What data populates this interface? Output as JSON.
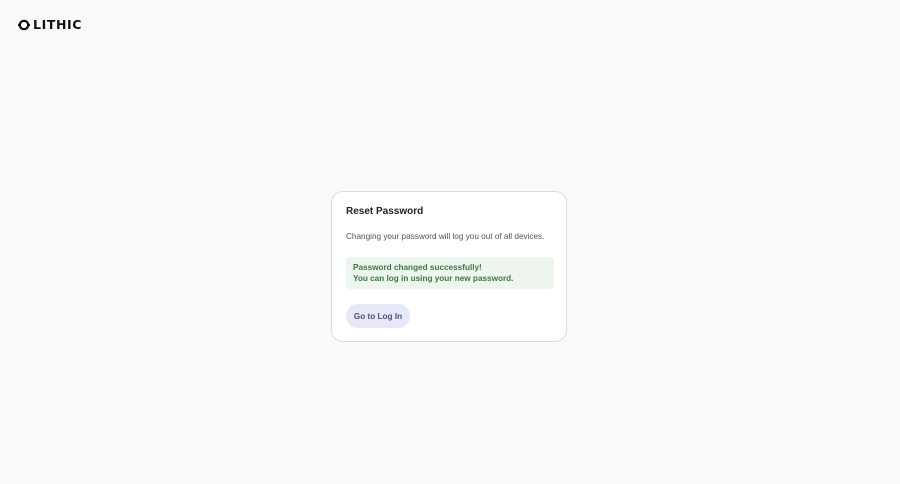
{
  "brand": {
    "name": "LITHIC",
    "logo_icon": "lithic-logo-mark"
  },
  "reset_card": {
    "title": "Reset Password",
    "description": "Changing your password will log you out of all devices.",
    "alert": {
      "line1": "Password changed successfully!",
      "line2": "You can log in using your new password.",
      "bg_color": "#eef4ee",
      "text_color": "#3b7a45"
    },
    "button_label": "Go to Log In",
    "button_bg": "#e7e8f5",
    "button_text_color": "#4a4f86"
  }
}
